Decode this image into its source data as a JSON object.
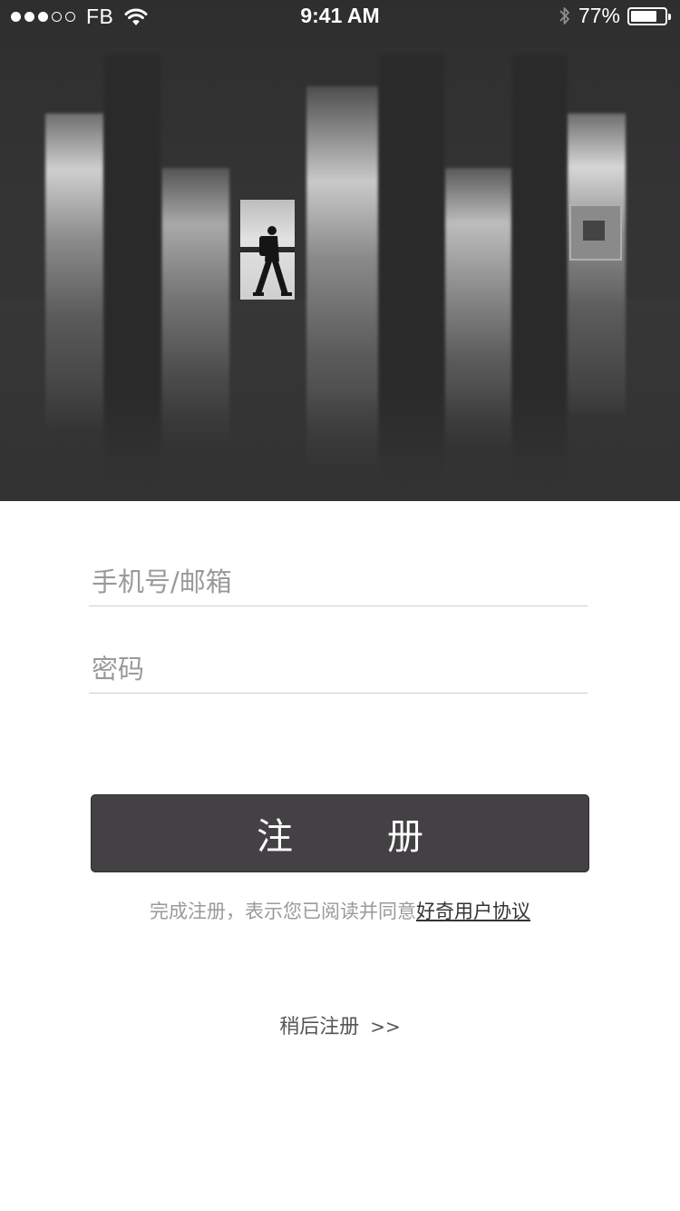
{
  "status_bar": {
    "signal_strength": 3,
    "signal_total": 5,
    "carrier": "FB",
    "time": "9:41 AM",
    "battery_percent": "77%",
    "battery_level": 0.77,
    "icons": [
      "signal-dots-icon",
      "wifi-icon",
      "bluetooth-icon",
      "battery-icon"
    ]
  },
  "hero": {
    "image": "hero-photo"
  },
  "form": {
    "phone_placeholder": "手机号/邮箱",
    "phone_value": "",
    "password_placeholder": "密码",
    "password_value": ""
  },
  "register_button": {
    "chars": [
      "注",
      "册"
    ]
  },
  "agreement": {
    "prefix": "完成注册，表示您已阅读并同意",
    "link": "好奇用户协议"
  },
  "later": {
    "label": "稍后注册",
    "arrows": ">>"
  },
  "colors": {
    "button_bg": "#434143",
    "hero_bg": "#343334",
    "divider": "#cfcfcf",
    "placeholder_text": "#9a9a9a"
  }
}
